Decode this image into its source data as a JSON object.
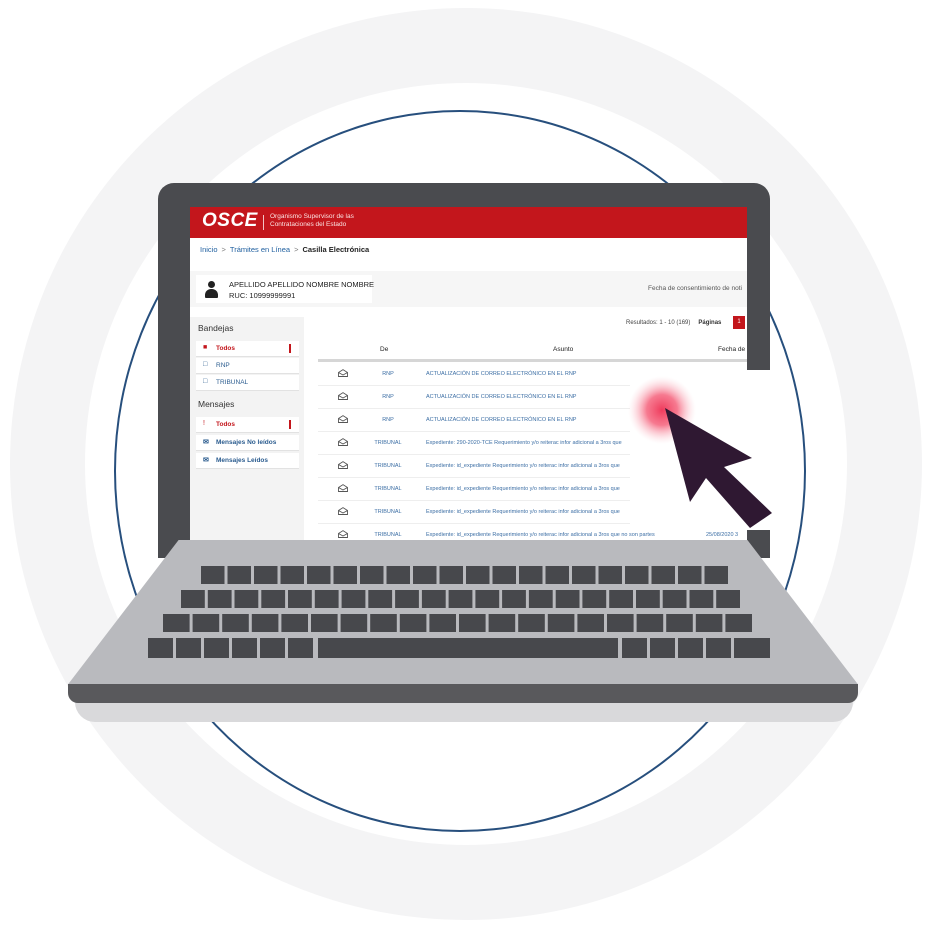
{
  "header": {
    "logo": "OSCE",
    "subtitle": "Organismo Supervisor de las Contrataciones del Estado"
  },
  "breadcrumb": {
    "home": "Inicio",
    "section": "Trámites en Línea",
    "current": "Casilla Electrónica",
    "separator": ">"
  },
  "user": {
    "name": "APELLIDO APELLIDO NOMBRE NOMBRE",
    "ruc": "RUC: 10999999991",
    "consent_label": "Fecha de consentimiento de noti"
  },
  "sidebar": {
    "bandejas_title": "Bandejas",
    "bandejas": [
      {
        "label": "Todos",
        "icon": "folder-open-icon"
      },
      {
        "label": "RNP",
        "icon": "folder-icon"
      },
      {
        "label": "TRIBUNAL",
        "icon": "folder-icon"
      }
    ],
    "mensajes_title": "Mensajes",
    "mensajes": [
      {
        "label": "Todos",
        "icon": "exclamation-icon"
      },
      {
        "label": "Mensajes No leídos",
        "icon": "envelope-closed-icon"
      },
      {
        "label": "Mensajes Leídos",
        "icon": "envelope-open-icon"
      }
    ]
  },
  "pagination": {
    "results": "Resultados: 1 - 10 (169)",
    "pages_label": "Páginas",
    "current_page": "1"
  },
  "table": {
    "columns": [
      "De",
      "Asunto",
      "Fecha de"
    ],
    "rows": [
      {
        "from": "RNP",
        "subject": "ACTUALIZACIÓN DE CORREO ELECTRÓNICO EN EL RNP",
        "date": "26/08/2020 06"
      },
      {
        "from": "RNP",
        "subject": "ACTUALIZACIÓN DE CORREO ELECTRÓNICO EN EL RNP",
        "date": ""
      },
      {
        "from": "RNP",
        "subject": "ACTUALIZACIÓN DE CORREO ELECTRÓNICO EN EL RNP",
        "date": ""
      },
      {
        "from": "TRIBUNAL",
        "subject": "Expediente: 290-2020-TCE Requerimiento y/o reiterac infor adicional a 3ros que",
        "date": ""
      },
      {
        "from": "TRIBUNAL",
        "subject": "Expediente: id_expediente Requerimiento y/o reiterac infor adicional a 3ros que",
        "date": ""
      },
      {
        "from": "TRIBUNAL",
        "subject": "Expediente: id_expediente Requerimiento y/o reiterac infor adicional a 3ros que",
        "date": ""
      },
      {
        "from": "TRIBUNAL",
        "subject": "Expediente: id_expediente Requerimiento y/o reiterac infor adicional a 3ros que",
        "date": ""
      },
      {
        "from": "TRIBUNAL",
        "subject": "Expediente: id_expediente Requerimiento y/o reiterac infor adicional a 3ros que no son partes",
        "date": "25/08/2020 3"
      }
    ]
  },
  "colors": {
    "brand_red": "#c3161c",
    "link_blue": "#3d6fa5",
    "ring_blue": "#274f7d",
    "cursor": "#2f1832",
    "click_glow": "#ee3b5c"
  },
  "icons": {
    "cursor": "mouse-pointer-icon",
    "click": "click-ripple-icon",
    "user": "user-icon"
  }
}
